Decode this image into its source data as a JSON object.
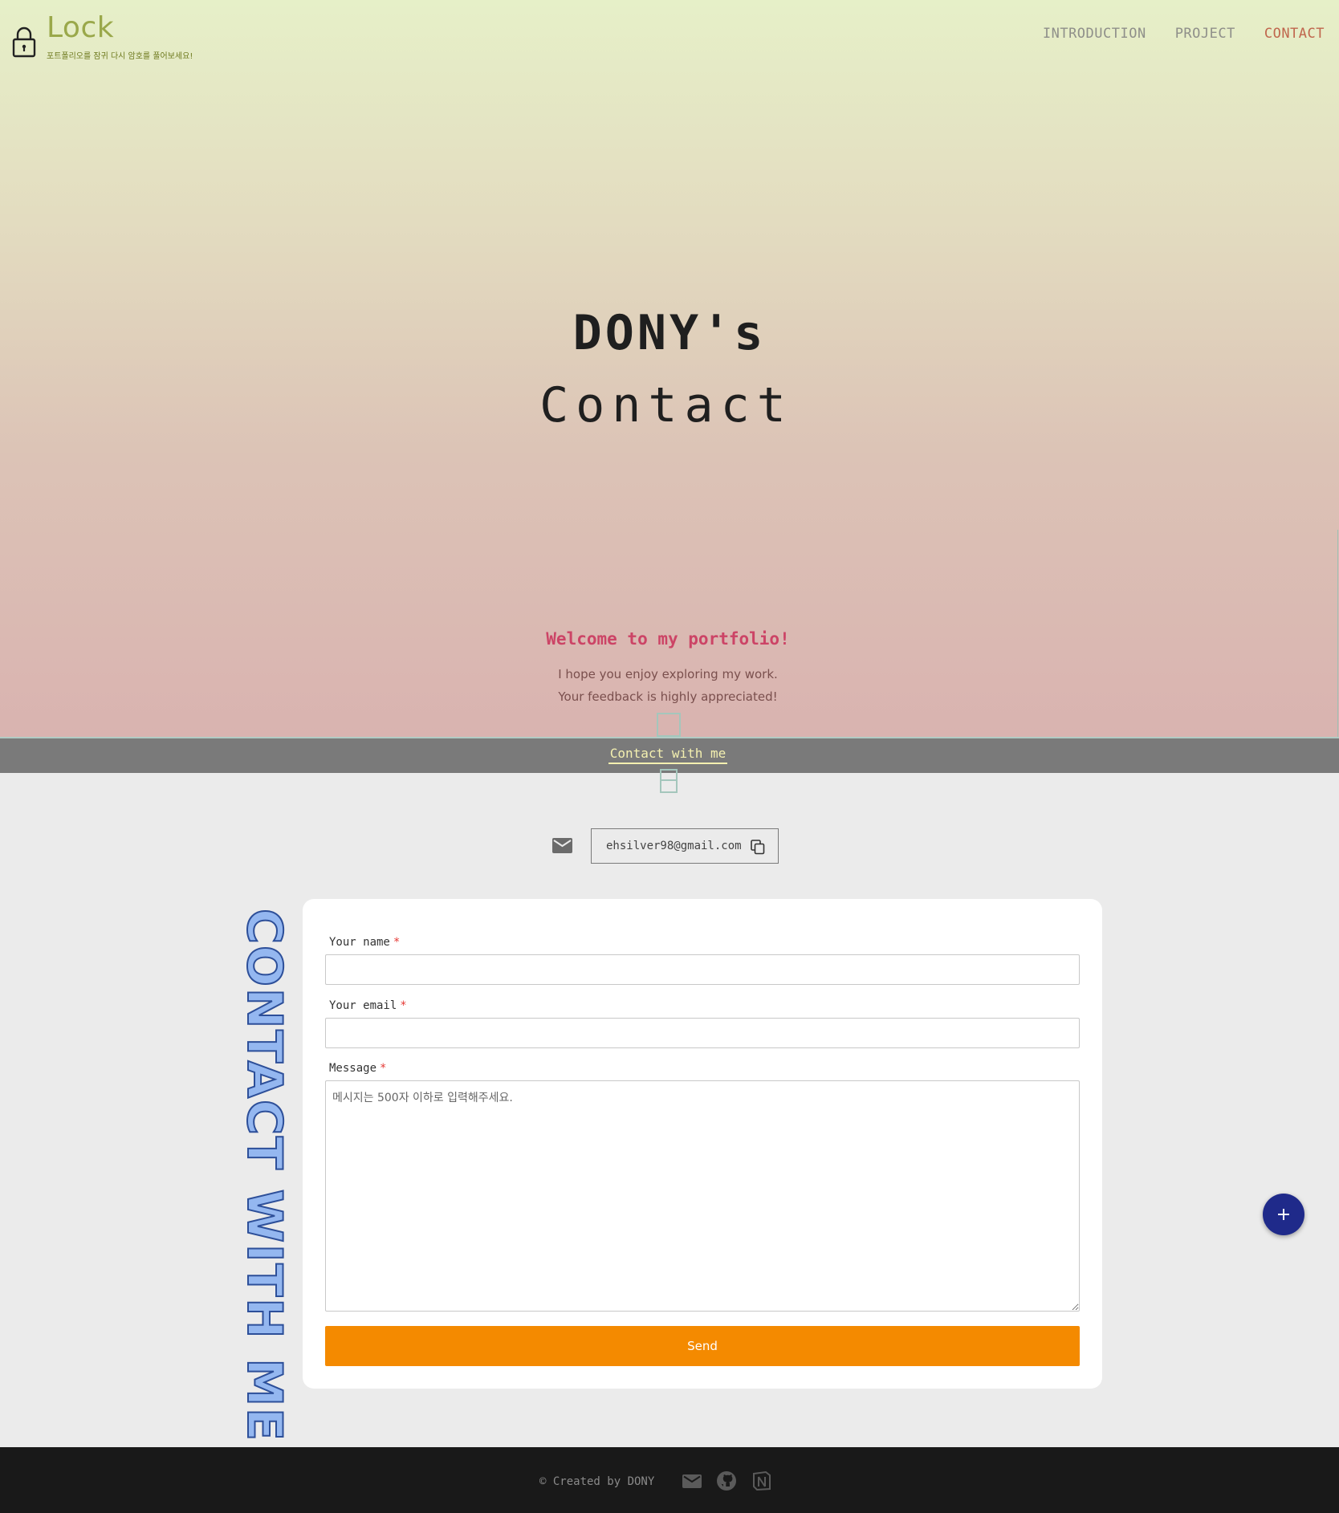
{
  "header": {
    "logo_title": "Lock",
    "logo_subtitle": "포트폴리오를 잠귀 다시 암호를 풀어보세요!",
    "logo_icon": "lock-icon",
    "nav": [
      {
        "label": "INTRODUCTION",
        "active": false
      },
      {
        "label": "PROJECT",
        "active": false
      },
      {
        "label": "CONTACT",
        "active": true
      }
    ]
  },
  "hero": {
    "title_line1": "DONY's",
    "title_line2": "Contact",
    "welcome": "Welcome to my portfolio!",
    "message_line1": "I hope you enjoy exploring my work.",
    "message_line2": "Your feedback is highly appreciated!"
  },
  "contact_bar": {
    "link_label": "Contact with me"
  },
  "email_row": {
    "icon": "mail-icon",
    "address": "ehsilver98@gmail.com",
    "copy_icon": "copy-icon"
  },
  "side_text": "CONTACT WITH ME",
  "form": {
    "name_label": "Your name",
    "name_value": "",
    "email_label": "Your email",
    "email_value": "",
    "message_label": "Message",
    "required_mark": "*",
    "message_placeholder": "메시지는 500자 이하로 입력해주세요.",
    "send_label": "Send"
  },
  "fab": {
    "icon": "plus-icon"
  },
  "footer": {
    "copyright": "© Created by DONY",
    "icons": [
      "mail-icon",
      "github-icon",
      "notion-icon"
    ]
  },
  "colors": {
    "logo": "#9aa84a",
    "nav_active": "#c0664d",
    "welcome": "#cc4466",
    "contact_bar": "#7a7a7a",
    "send_button": "#f48a00",
    "fab": "#1f2a8a",
    "footer": "#191919",
    "side_text_fill": "#94b7f0"
  }
}
